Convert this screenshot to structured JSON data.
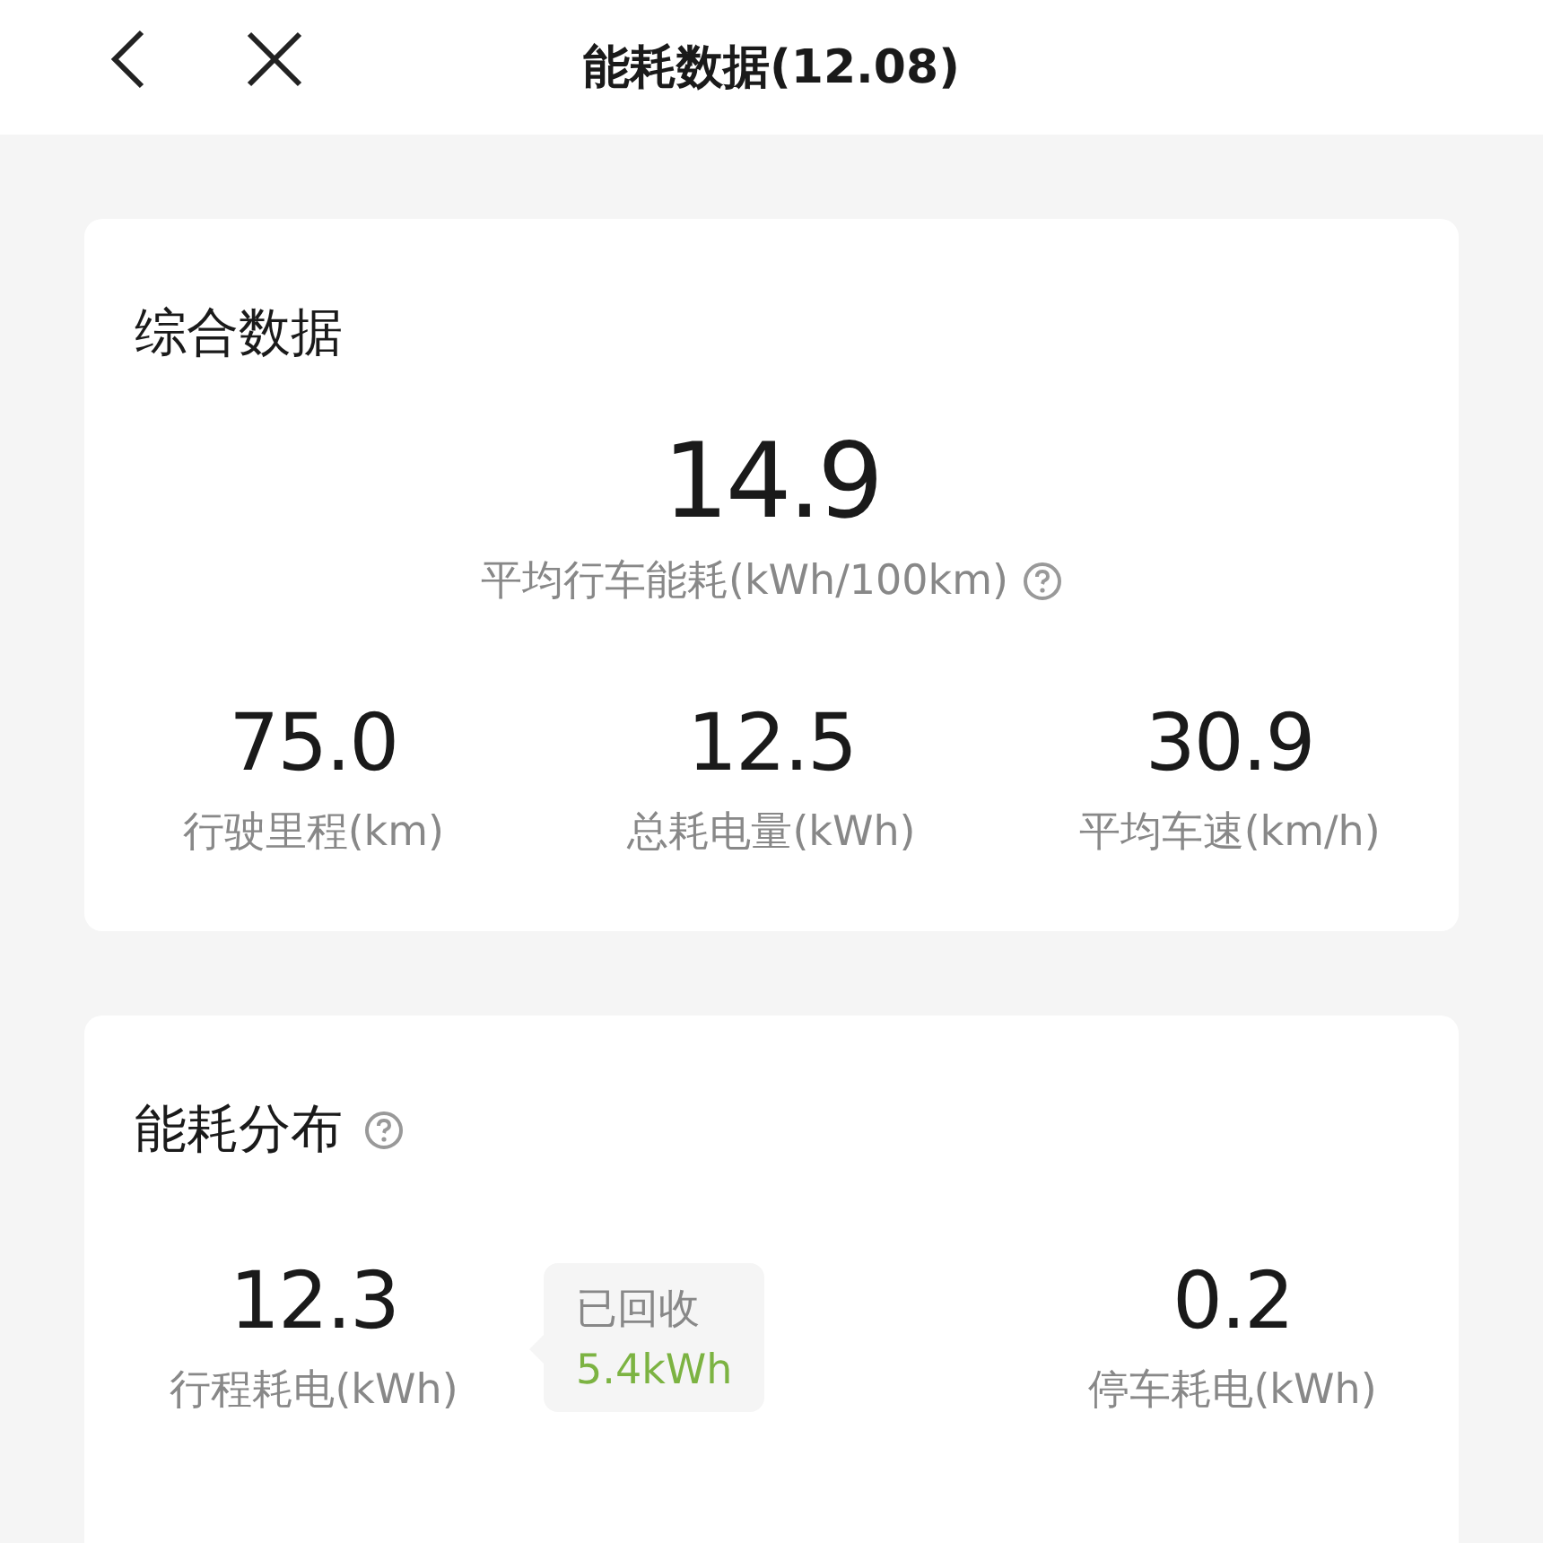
{
  "title": "能耗数据(12.08)",
  "summary": {
    "heading": "综合数据",
    "main": {
      "value": "14.9",
      "label": "平均行车能耗(kWh/100km)"
    },
    "stats": [
      {
        "value": "75.0",
        "label": "行驶里程(km)"
      },
      {
        "value": "12.5",
        "label": "总耗电量(kWh)"
      },
      {
        "value": "30.9",
        "label": "平均车速(km/h)"
      }
    ]
  },
  "distribution": {
    "heading": "能耗分布",
    "stats": [
      {
        "value": "12.3",
        "label": "行程耗电(kWh)"
      },
      {
        "value": "0.2",
        "label": "停车耗电(kWh)"
      }
    ],
    "recovered": {
      "label": "已回收",
      "value": "5.4kWh"
    }
  }
}
